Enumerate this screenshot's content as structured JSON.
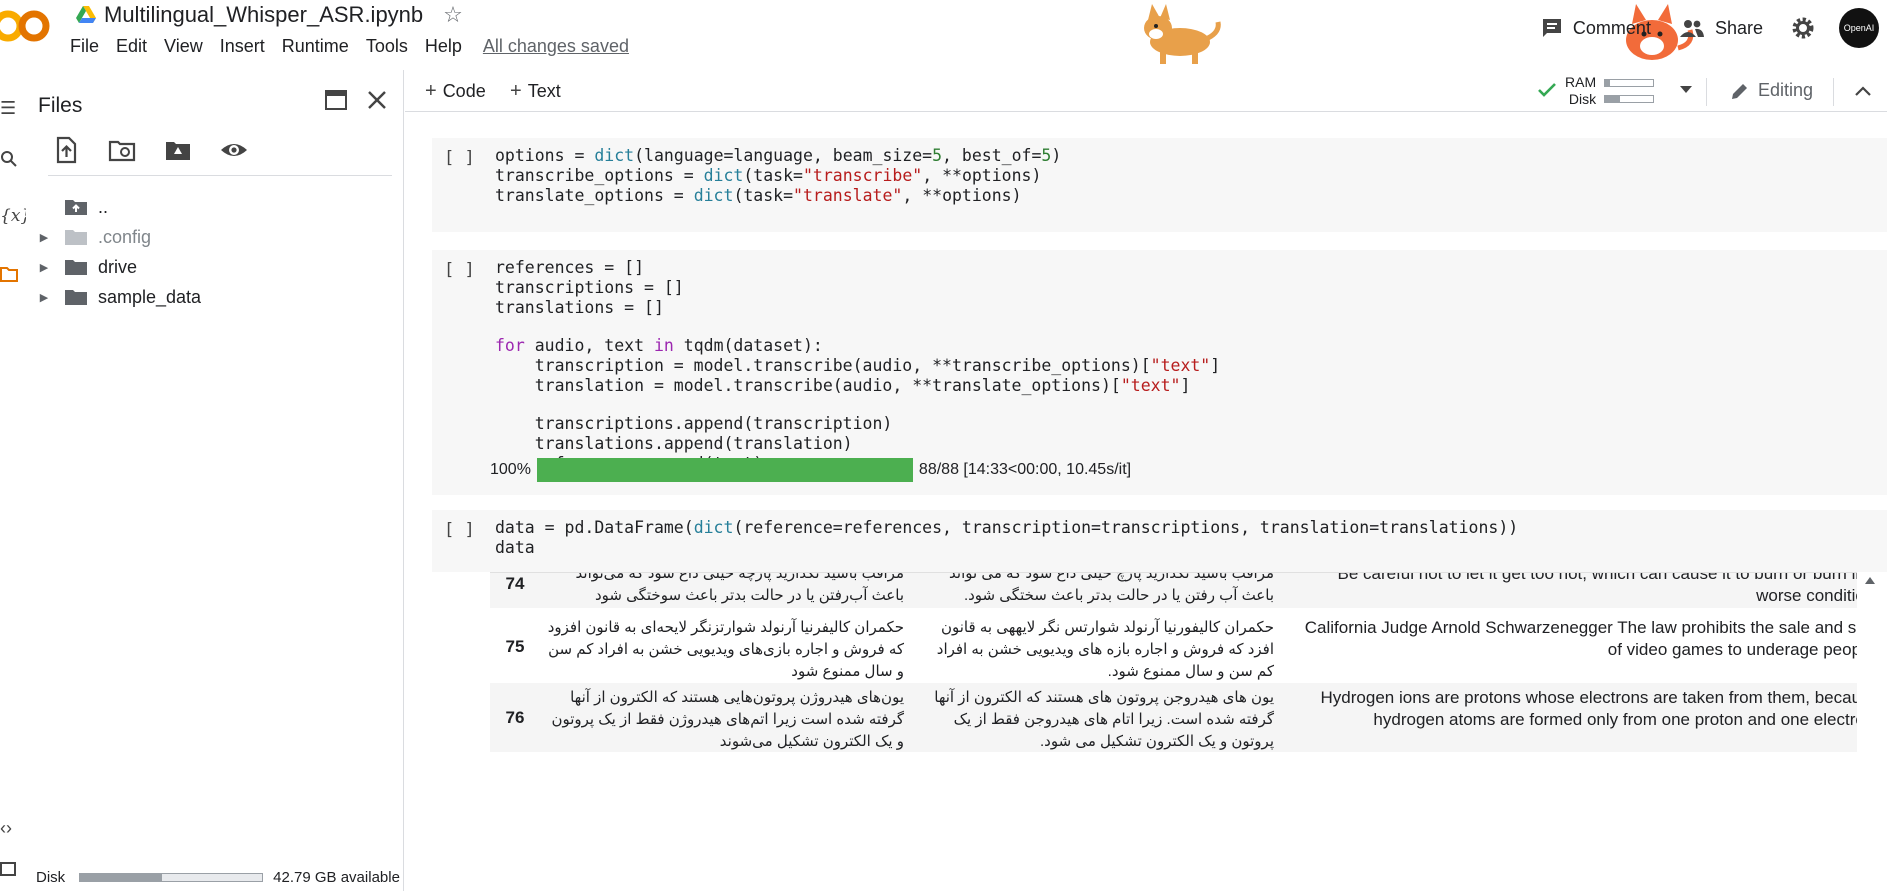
{
  "header": {
    "notebook_title": "Multilingual_Whisper_ASR.ipynb",
    "menu": [
      "File",
      "Edit",
      "View",
      "Insert",
      "Runtime",
      "Tools",
      "Help"
    ],
    "saved_status": "All changes saved",
    "comment_label": "Comment",
    "share_label": "Share",
    "avatar_label": "OpenAI"
  },
  "files_panel": {
    "title": "Files",
    "tree": [
      {
        "name": "..",
        "expandable": false
      },
      {
        "name": ".config",
        "expandable": true
      },
      {
        "name": "drive",
        "expandable": true
      },
      {
        "name": "sample_data",
        "expandable": true
      }
    ],
    "disk_label": "Disk",
    "disk_available": "42.79 GB available",
    "disk_used_fraction": 0.45
  },
  "toolbar": {
    "code_label": "Code",
    "text_label": "Text",
    "ram_label": "RAM",
    "disk_label": "Disk",
    "ram_used_fraction": 0.1,
    "disk_used_fraction": 0.3,
    "editing_label": "Editing"
  },
  "cells": {
    "run_marker": "[ ]",
    "progress": {
      "percent_label": "100%",
      "fraction": 1.0,
      "detail": "88/88 [14:33<00:00, 10.45s/it]"
    }
  },
  "table_rows": [
    {
      "index": "74",
      "transcription": "مراقب باشید نگذارید پارچه خیلی داغ شود که می‌تواند باعث آب‌رفتن یا در حالت بدتر باعث سوختگی شود",
      "translation_fa": "مراقب باشید نگذارید پارچ خیلی داغ شود که می تواند باعث آب رفتن یا در حالت بدتر باعث سختگی شود.",
      "english": "Be careful not to let it get too hot, which can cause it to burn or burn in a worse condition."
    },
    {
      "index": "75",
      "transcription": "حکمران کالیفرنیا آرنولد شوارتزنگر لایحه‌ای به قانون افزود که فروش و اجاره بازی‌های ویدیویی خشن به افراد کم سن و سال ممنوع شود",
      "translation_fa": "حکمران کالیفورنیا آرنولد شوارتس نگر لایههی به قانون افزد که فروش و اجاره بازه های ویدیویی خشن به افراد کم سن و سال ممنوع شود.",
      "english": "California Judge Arnold Schwarzenegger The law prohibits the sale and sale of video games to underage people."
    },
    {
      "index": "76",
      "transcription": "یون‌های هیدروژن پروتون‌هایی هستند که الکترون از آنها گرفته شده است زیرا اتم‌های هیدروژن فقط از یک پروتون و یک الکترون تشکیل می‌شوند",
      "translation_fa": "یون های هیدروجن پروتون های هستند که الکترون از آنها گرفته شده است. زیرا اتام های هیدروجن فقط از یک پروتون و یک الکترون تشکیل می شود.",
      "english": "Hydrogen ions are protons whose electrons are taken from them, because hydrogen atoms are formed only from one proton and one electron."
    }
  ]
}
